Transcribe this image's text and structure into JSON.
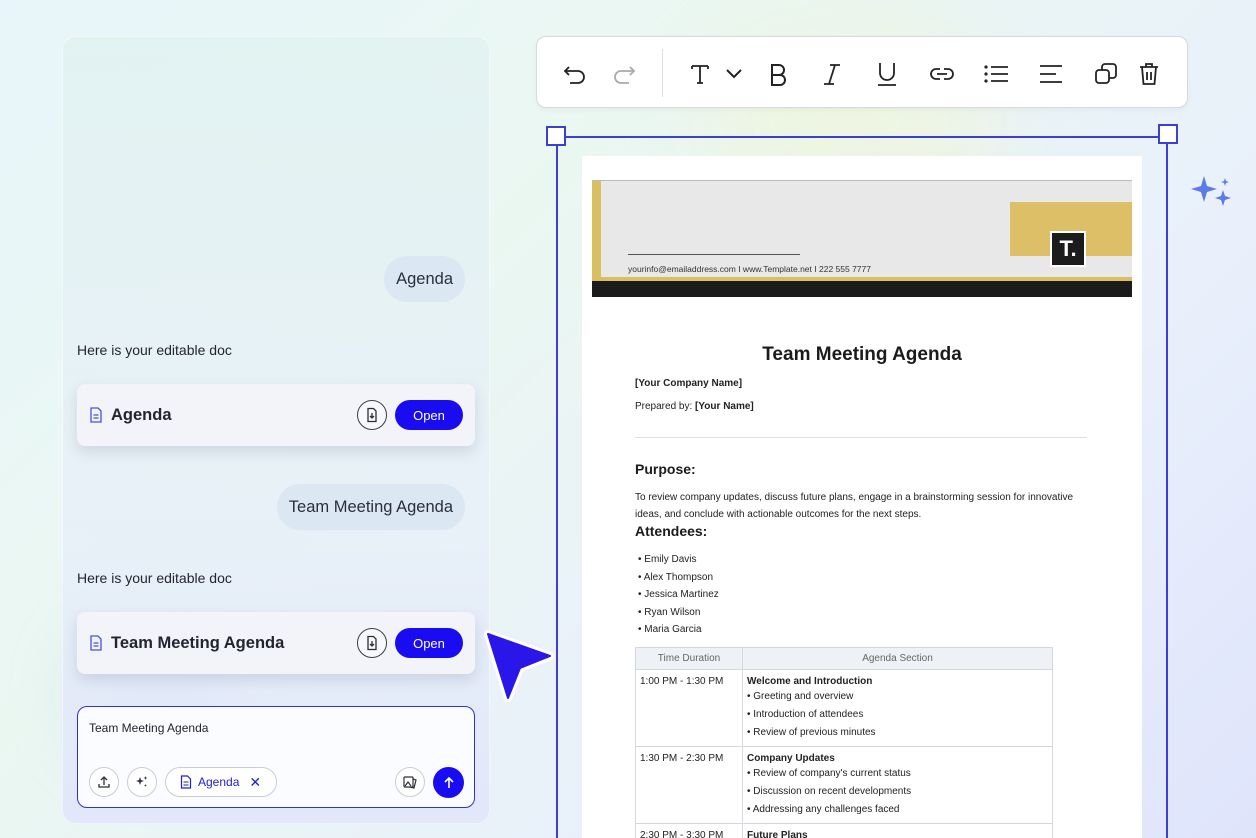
{
  "chat": {
    "messages": [
      {
        "role": "user",
        "text": "Agenda"
      },
      {
        "role": "assistant",
        "text": "Here is your editable doc",
        "doc_title": "Agenda",
        "open_label": "Open"
      },
      {
        "role": "user",
        "text": "Team Meeting Agenda"
      },
      {
        "role": "assistant",
        "text": "Here is your editable doc",
        "doc_title": "Team Meeting Agenda",
        "open_label": "Open"
      }
    ],
    "input": {
      "value": "Team Meeting Agenda",
      "chip_label": "Agenda"
    }
  },
  "document": {
    "header_contact": "yourinfo@emailaddress.com  I  www.Template.net  I  222 555 7777",
    "logo_text": "T.",
    "title": "Team Meeting Agenda",
    "company": "[Your Company Name]",
    "prepared_by_label": "Prepared by:",
    "prepared_by_value": "[Your Name]",
    "purpose_heading": "Purpose:",
    "purpose_text": "To review company updates, discuss future plans, engage in a brainstorming session for innovative ideas, and conclude with actionable outcomes for the next steps.",
    "attendees_heading": "Attendees:",
    "attendees": [
      "Emily Davis",
      "Alex Thompson",
      "Jessica Martinez",
      "Ryan Wilson",
      "Maria Garcia"
    ],
    "table": {
      "headers": [
        "Time Duration",
        "Agenda Section"
      ],
      "rows": [
        {
          "time": "1:00 PM - 1:30 PM",
          "section": "Welcome and Introduction",
          "items": [
            "Greeting and overview",
            "Introduction of attendees",
            "Review of previous minutes"
          ]
        },
        {
          "time": "1:30 PM - 2:30 PM",
          "section": "Company Updates",
          "items": [
            "Review of company's current status",
            "Discussion on recent developments",
            "Addressing any challenges faced"
          ]
        },
        {
          "time": "2:30 PM - 3:30 PM",
          "section": "Future Plans",
          "items": []
        }
      ]
    }
  },
  "colors": {
    "accent": "#1a0cf0",
    "frame": "#3b3fd6",
    "gold": "#d9be62"
  }
}
